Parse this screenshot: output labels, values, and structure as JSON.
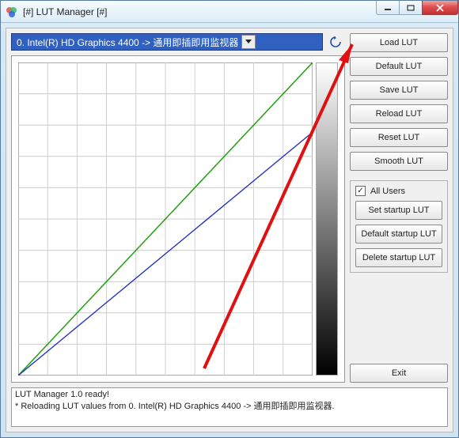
{
  "window": {
    "title": "[#] LUT Manager [#]"
  },
  "device": {
    "selected": "0. Intel(R) HD Graphics 4400 -> 通用即插即用监视器"
  },
  "buttons": {
    "load": "Load LUT",
    "default": "Default LUT",
    "save": "Save LUT",
    "reload": "Reload LUT",
    "reset": "Reset LUT",
    "smooth": "Smooth LUT",
    "set_startup": "Set startup LUT",
    "default_startup": "Default startup LUT",
    "delete_startup": "Delete startup LUT",
    "exit": "Exit"
  },
  "checkbox": {
    "all_users": "All Users",
    "checked": true
  },
  "log": {
    "line1": "LUT Manager 1.0 ready!",
    "line2": "* Reloading LUT values from 0. Intel(R) HD Graphics 4400 -> 通用即插即用监视器."
  },
  "chart_data": {
    "type": "line",
    "x": [
      0,
      255
    ],
    "series": [
      {
        "name": "red",
        "color": "#d02020",
        "values": [
          0,
          255
        ]
      },
      {
        "name": "green",
        "color": "#10b010",
        "values": [
          0,
          255
        ]
      },
      {
        "name": "blue",
        "color": "#2030c0",
        "values": [
          0,
          198
        ]
      }
    ],
    "xlim": [
      0,
      255
    ],
    "ylim": [
      0,
      255
    ],
    "grid": true,
    "grid_divisions": 10
  }
}
